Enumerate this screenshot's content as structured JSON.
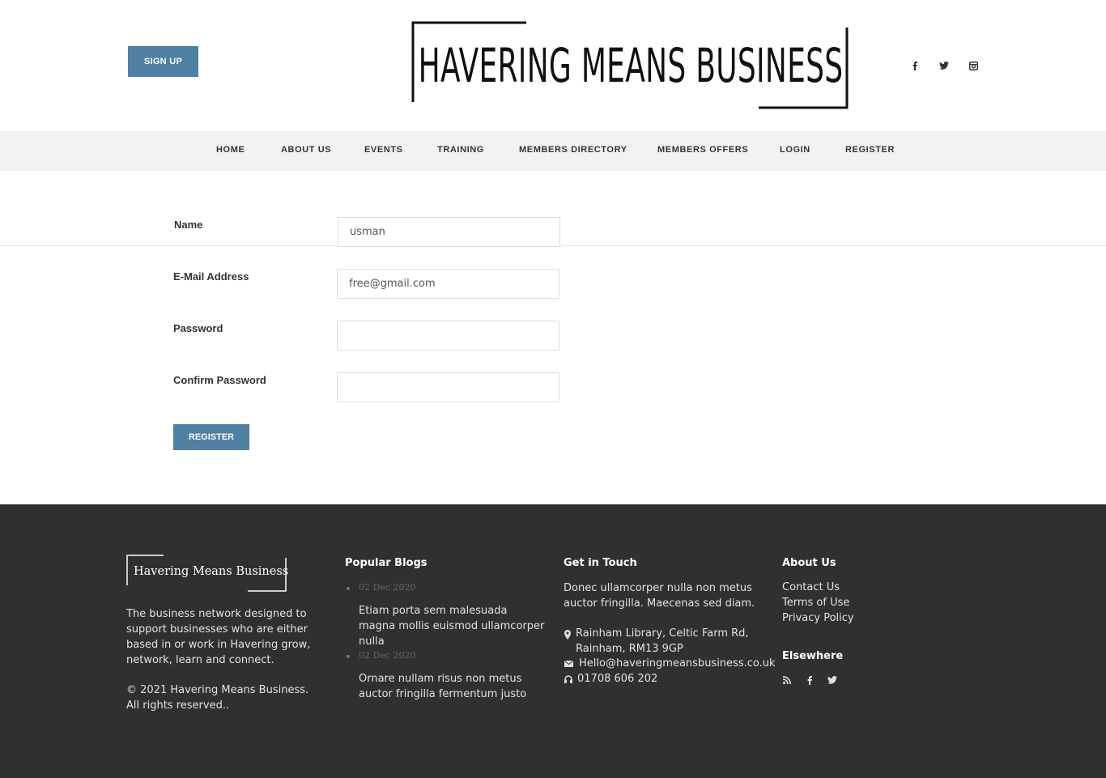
{
  "header": {
    "signup_label": "SIGN UP",
    "logo_text": "HAVERING MEANS BUSINESS",
    "social": [
      "f",
      "t",
      "i"
    ]
  },
  "nav": {
    "items": [
      "HOME",
      "ABOUT US",
      "EVENTS",
      "TRAINING",
      "MEMBERS DIRECTORY",
      "MEMBERS OFFERS",
      "LOGIN",
      "REGISTER"
    ]
  },
  "form": {
    "name_label": "Name",
    "name_value": "usman",
    "email_label": "E-Mail Address",
    "email_value": "free@gmail.com",
    "password_label": "Password",
    "password_value": "",
    "confirm_label": "Confirm Password",
    "confirm_value": "",
    "register_label": "REGISTER"
  },
  "footer": {
    "logo_text": "Havering Means Business",
    "about_text": "The business network designed to support businesses who are either based in or work in Havering grow, network, learn and connect.",
    "copyright": "© 2021 Havering Means Business. All rights reserved..",
    "popular_heading": "Popular Blogs",
    "blogs": [
      {
        "date": "02 Dec 2020",
        "title": "Etiam porta sem malesuada magna mollis euismod ullamcorper nulla"
      },
      {
        "date": "02 Dec 2020",
        "title": "Ornare nullam risus non metus auctor fringilla fermentum justo"
      }
    ],
    "contact_heading": "Get in Touch",
    "contact_text": "Donec ullamcorper nulla non metus auctor fringilla. Maecenas sed diam.",
    "address": "Rainham Library, Celtic Farm Rd, Rainham, RM13 9GP",
    "email": "Hello@haveringmeansbusiness.co.uk",
    "phone": "01708 606 202",
    "about_heading": "About Us",
    "about_links": [
      "Contact Us",
      "Terms of Use",
      "Privacy Policy"
    ],
    "elsewhere_heading": "Elsewhere",
    "accent_color": "#4f7fa3"
  }
}
